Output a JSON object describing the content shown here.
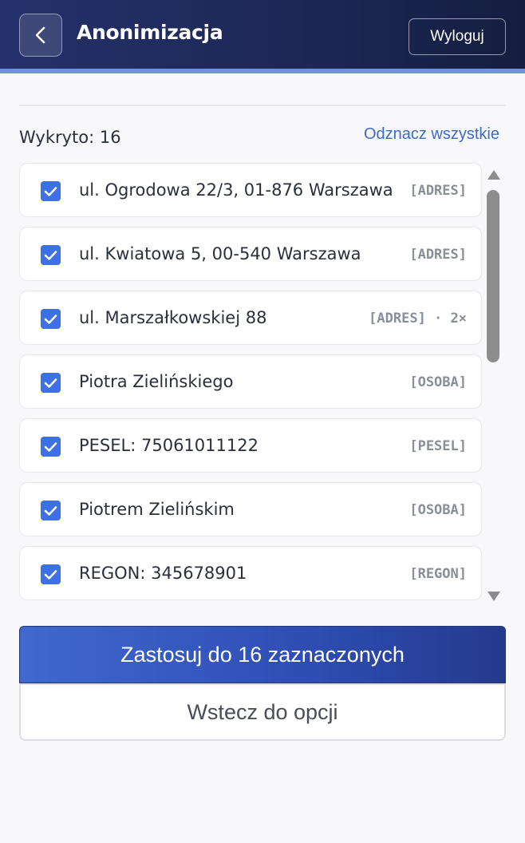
{
  "header": {
    "title": "Anonimizacja",
    "logout_label": "Wyloguj"
  },
  "summary": {
    "detected_label": "Wykryto: 16",
    "deselect_all_label": "Odznacz wszystkie"
  },
  "items": [
    {
      "text": "ul. Ogrodowa 22/3, 01-876 Warszawa",
      "tag": "[ADRES]",
      "checked": true
    },
    {
      "text": "ul. Kwiatowa 5, 00-540 Warszawa",
      "tag": "[ADRES]",
      "checked": true
    },
    {
      "text": "ul. Marszałkowskiej 88",
      "tag": "[ADRES] · 2×",
      "checked": true
    },
    {
      "text": "Piotra Zielińskiego",
      "tag": "[OSOBA]",
      "checked": true
    },
    {
      "text": "PESEL: 75061011122",
      "tag": "[PESEL]",
      "checked": true
    },
    {
      "text": "Piotrem Zielińskim",
      "tag": "[OSOBA]",
      "checked": true
    },
    {
      "text": "REGON: 345678901",
      "tag": "[REGON]",
      "checked": true
    }
  ],
  "actions": {
    "apply_label": "Zastosuj do 16 zaznaczonych",
    "back_to_options_label": "Wstecz do opcji"
  },
  "icons": {
    "back": "chevron-left-icon",
    "checkbox": "checkmark-icon",
    "scroll_up": "triangle-up-icon",
    "scroll_down": "triangle-down-icon"
  },
  "colors": {
    "header": "#1d2857",
    "accent": "#6f93db",
    "checkbox": "#3d6fe8",
    "link": "#3d6ac9",
    "primary_button": "#2e4db3"
  }
}
